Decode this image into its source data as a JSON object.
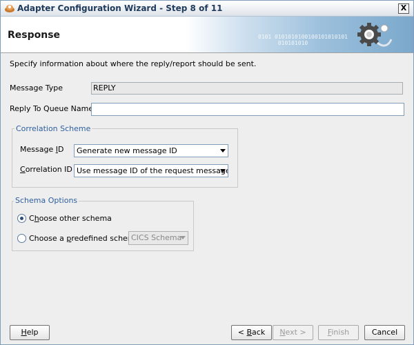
{
  "window": {
    "title": "Adapter Configuration Wizard - Step 8 of 11",
    "close_label": "X"
  },
  "header": {
    "title": "Response",
    "banner_bits": "0101 0101010100100101010101\n      010101010"
  },
  "main": {
    "description": "Specify information about where the reply/report should be sent.",
    "message_type": {
      "label": "Message Type",
      "value": "REPLY"
    },
    "reply_to_queue": {
      "label": "Reply To Queue Name",
      "value": ""
    },
    "correlation": {
      "legend": "Correlation Scheme",
      "message_id": {
        "label_pre": "Message ",
        "label_u": "I",
        "label_post": "D",
        "value": "Generate new message ID"
      },
      "correlation_id": {
        "label_pre": "",
        "label_u": "C",
        "label_post": "orrelation ID",
        "value": "Use message ID of the request message"
      }
    },
    "schema": {
      "legend": "Schema Options",
      "other": {
        "pre": "C",
        "u": "h",
        "post": "oose other schema",
        "checked": true
      },
      "predefined": {
        "pre": "Choose a ",
        "u": "p",
        "post": "redefined schema",
        "checked": false
      },
      "predefined_value": "CICS Schema"
    }
  },
  "footer": {
    "help": {
      "pre": "",
      "u": "H",
      "post": "elp"
    },
    "back": {
      "pre": "< ",
      "u": "B",
      "post": "ack"
    },
    "next": {
      "pre": "",
      "u": "N",
      "post": "ext >"
    },
    "finish": {
      "pre": "",
      "u": "F",
      "post": "inish"
    },
    "cancel": "Cancel"
  }
}
